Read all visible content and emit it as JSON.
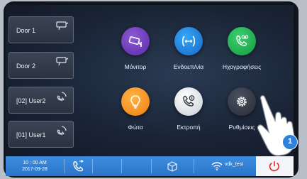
{
  "contacts": [
    {
      "label": "Door 1",
      "icon": "camera-icon"
    },
    {
      "label": "Door 2",
      "icon": "camera-icon"
    },
    {
      "label": "[02] User2",
      "icon": "handset-icon"
    },
    {
      "label": "[01] User1",
      "icon": "handset-icon"
    }
  ],
  "apps": [
    {
      "label": "Μόνιτορ",
      "icon": "cctv-camera-icon",
      "color": "#7a45c8"
    },
    {
      "label": "Ενδοεπ/νία",
      "icon": "intercom-icon",
      "color": "#2a8be6"
    },
    {
      "label": "Ηχογραφήσεις",
      "icon": "voicemail-icon",
      "color": "#22b24f"
    },
    {
      "label": "Φώτα",
      "icon": "light-bulb-icon",
      "color": "#f7931e"
    },
    {
      "label": "Εκτροπή",
      "icon": "call-forward-icon",
      "color": "#e6e8ec"
    },
    {
      "label": "Ρυθμίσεις",
      "icon": "gear-icon",
      "color": "#3a414d"
    }
  ],
  "status_bar": {
    "time": "10 : 00 AM",
    "date": "2017-09-28",
    "wifi_name": "vdk_test",
    "call_log_icon": "call-log-icon",
    "package_icon": "package-icon",
    "wifi_icon": "wifi-icon",
    "power_icon": "power-icon"
  },
  "callout": {
    "number": "1"
  },
  "colors": {
    "bar": "#2f7fd6",
    "accent_red": "#e0262b",
    "badge": "#2f7fdb"
  }
}
